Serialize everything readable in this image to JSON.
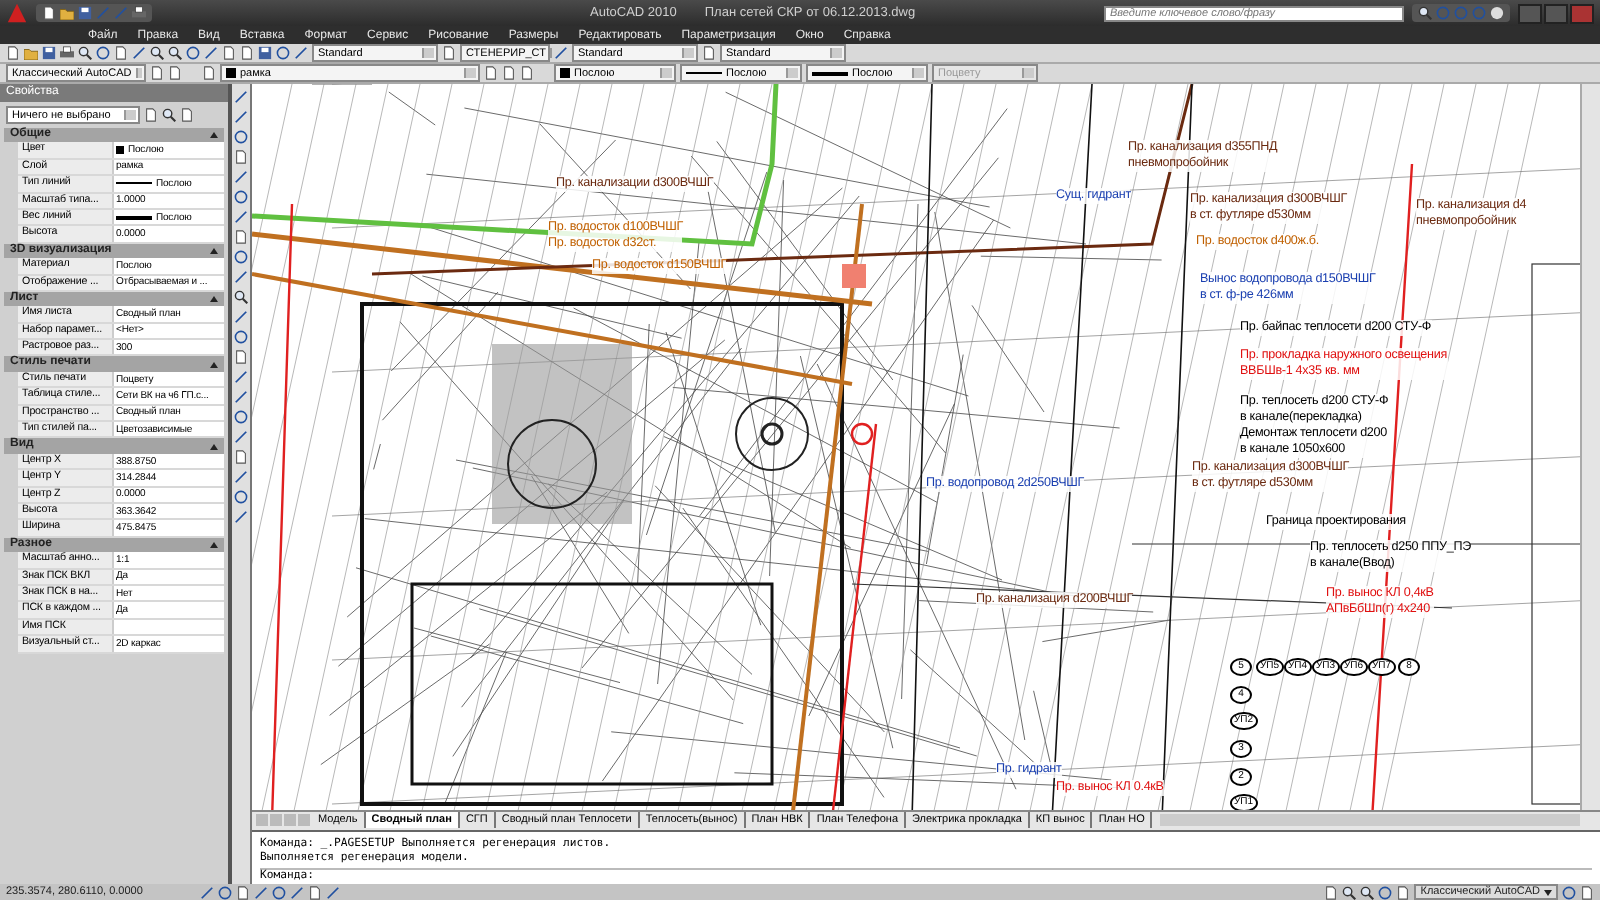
{
  "window": {
    "title": "AutoCAD 2010",
    "document": "План сетей СКР от 06.12.2013.dwg",
    "search": {
      "placeholder": "Введите ключевое слово/фразу"
    }
  },
  "menu": [
    "Файл",
    "Правка",
    "Вид",
    "Вставка",
    "Формат",
    "Сервис",
    "Рисование",
    "Размеры",
    "Редактировать",
    "Параметризация",
    "Окно",
    "Справка"
  ],
  "toolbar_1": {
    "styles": [
      "Standard",
      "СТЕНЕРИР_СТ",
      "Standard",
      "Standard"
    ]
  },
  "toolbar_2": {
    "workspace": "Классический AutoCAD",
    "layer": "рамка",
    "color_setting": "Послою",
    "linetype": "Послою",
    "lineweight": "Послою",
    "plotstyle": {
      "value": "Поцвету",
      "disabled": true
    }
  },
  "properties": {
    "title": "Свойства",
    "selection": "Ничего не выбрано",
    "sections": [
      {
        "title": "Общие",
        "expanded": true,
        "rows": [
          {
            "label": "Цвет",
            "value": "Послою",
            "kind": "swatch"
          },
          {
            "label": "Слой",
            "value": "рамка",
            "kind": "text"
          },
          {
            "label": "Тип линий",
            "value": "Послою",
            "kind": "thin-line"
          },
          {
            "label": "Масштаб типа...",
            "value": "1.0000",
            "kind": "text"
          },
          {
            "label": "Вес линий",
            "value": "Послою",
            "kind": "thick-line"
          },
          {
            "label": "Высота",
            "value": "0.0000",
            "kind": "text"
          }
        ]
      },
      {
        "title": "3D визуализация",
        "expanded": true,
        "rows": [
          {
            "label": "Материал",
            "value": "Послою",
            "kind": "text"
          },
          {
            "label": "Отображение ...",
            "value": "Отбрасываемая и ...",
            "kind": "text"
          }
        ]
      },
      {
        "title": "Лист",
        "expanded": true,
        "rows": [
          {
            "label": "Имя листа",
            "value": "Сводный план",
            "kind": "text"
          },
          {
            "label": "Набор парамет...",
            "value": "<Нет>",
            "kind": "text"
          },
          {
            "label": "Растровое раз...",
            "value": "300",
            "kind": "text"
          }
        ]
      },
      {
        "title": "Стиль печати",
        "expanded": true,
        "rows": [
          {
            "label": "Стиль печати",
            "value": "Поцвету",
            "kind": "text"
          },
          {
            "label": "Таблица стиле...",
            "value": "Сети ВК на ч6 ГП.c...",
            "kind": "text"
          },
          {
            "label": "Пространство ...",
            "value": "Сводный план",
            "kind": "text"
          },
          {
            "label": "Тип стилей па...",
            "value": "Цветозависимые",
            "kind": "text"
          }
        ]
      },
      {
        "title": "Вид",
        "expanded": true,
        "rows": [
          {
            "label": "Центр X",
            "value": "388.8750",
            "kind": "text"
          },
          {
            "label": "Центр Y",
            "value": "314.2844",
            "kind": "text"
          },
          {
            "label": "Центр Z",
            "value": "0.0000",
            "kind": "text"
          },
          {
            "label": "Высота",
            "value": "363.3642",
            "kind": "text"
          },
          {
            "label": "Ширина",
            "value": "475.8475",
            "kind": "text"
          }
        ]
      },
      {
        "title": "Разное",
        "expanded": true,
        "rows": [
          {
            "label": "Масштаб анно...",
            "value": "1:1",
            "kind": "text"
          },
          {
            "label": "Знак ПСК ВКЛ",
            "value": "Да",
            "kind": "text"
          },
          {
            "label": "Знак ПСК в на...",
            "value": "Нет",
            "kind": "text"
          },
          {
            "label": "ПСК в каждом ...",
            "value": "Да",
            "kind": "text"
          },
          {
            "label": "Имя ПСК",
            "kind": "text"
          },
          {
            "label": "Визуальный ст...",
            "value": "2D каркас",
            "kind": "text"
          }
        ]
      }
    ]
  },
  "annotations": [
    {
      "lines": [
        "Пр. канализации d300ВЧШГ"
      ],
      "color": "#6b2a10"
    },
    {
      "lines": [
        "Пр. водосток d100ВЧШГ",
        "Пр. водосток d32ст."
      ],
      "color": "#c06000"
    },
    {
      "lines": [
        "Пр. водосток d150ВЧШГ"
      ],
      "color": "#c06000"
    },
    {
      "lines": [
        "Сущ. гидрант"
      ],
      "color": "#1a3fb0"
    },
    {
      "lines": [
        "Пр. канализация d355ПНД",
        "пневмопробойник"
      ],
      "color": "#6b2a10"
    },
    {
      "lines": [
        "Пр. канализация d300ВЧШГ",
        "в ст. футляре d530мм"
      ],
      "color": "#6b2a10"
    },
    {
      "lines": [
        "Пр. водосток d400ж.б."
      ],
      "color": "#c06000"
    },
    {
      "lines": [
        "Пр. канализация d4",
        "пневмопробойник"
      ],
      "color": "#6b2a10"
    },
    {
      "lines": [
        "Вынос водопровода d150ВЧШГ",
        "в ст. ф-ре 426мм"
      ],
      "color": "#1a3fb0"
    },
    {
      "lines": [
        "Пр. байпас теплосети d200 СТУ-Ф"
      ],
      "color": "#000000"
    },
    {
      "lines": [
        "Пр. прокладка наружного освещения",
        "ВВБШв-1 4х35 кв. мм"
      ],
      "color": "#e01010"
    },
    {
      "lines": [
        "Пр. теплосеть d200 СТУ-Ф",
        "в канале(перекладка)",
        "Демонтаж теплосети d200",
        "в канале 1050х600"
      ],
      "color": "#000000"
    },
    {
      "lines": [
        "Пр. водопровод 2d250ВЧШГ"
      ],
      "color": "#1a3fb0"
    },
    {
      "lines": [
        "Пр. канализация d300ВЧШГ",
        "в ст. футляре d530мм"
      ],
      "color": "#6b2a10"
    },
    {
      "lines": [
        "Граница проектирования"
      ],
      "color": "#000000"
    },
    {
      "lines": [
        "Пр. теплосеть d250 ППУ_ПЭ",
        "в канале(Ввод)"
      ],
      "color": "#000000"
    },
    {
      "lines": [
        "Пр. канализация d200ВЧШГ"
      ],
      "color": "#6b2a10"
    },
    {
      "lines": [
        "Пр. вынос КЛ 0,4кВ",
        "АПвБбШп(г) 4х240"
      ],
      "color": "#e01010"
    },
    {
      "lines": [
        "Пр. гидрант"
      ],
      "color": "#1a3fb0"
    },
    {
      "lines": [
        "Пр. вынос КЛ 0.4кВ"
      ],
      "color": "#e01010"
    }
  ],
  "markers": [
    "5",
    "УП5",
    "УП4",
    "УП3",
    "УП6",
    "УП7",
    "8",
    "4",
    "УП2",
    "3",
    "2",
    "УП1"
  ],
  "layout_tabs": [
    {
      "label": "Модель",
      "selected": false
    },
    {
      "label": "Сводный план",
      "selected": true
    },
    {
      "label": "СГП",
      "selected": false
    },
    {
      "label": "Сводный план Теплосети",
      "selected": false
    },
    {
      "label": "Теплосеть(вынос)",
      "selected": false
    },
    {
      "label": "План НВК",
      "selected": false
    },
    {
      "label": "План Телефона",
      "selected": false
    },
    {
      "label": "Электрика прокладка",
      "selected": false
    },
    {
      "label": "КП вынос",
      "selected": false
    },
    {
      "label": "План НО",
      "selected": false
    }
  ],
  "command_history": [
    "Команда:  _.PAGESETUP Выполняется регенерация листов.",
    "Выполняется регенерация модели."
  ],
  "command_prompt": "Команда:",
  "status_bar": {
    "coordinates": "235.3574, 280.6110, 0.0000",
    "workspace": {
      "label": "Классический AutoCAD",
      "selected": true
    }
  }
}
